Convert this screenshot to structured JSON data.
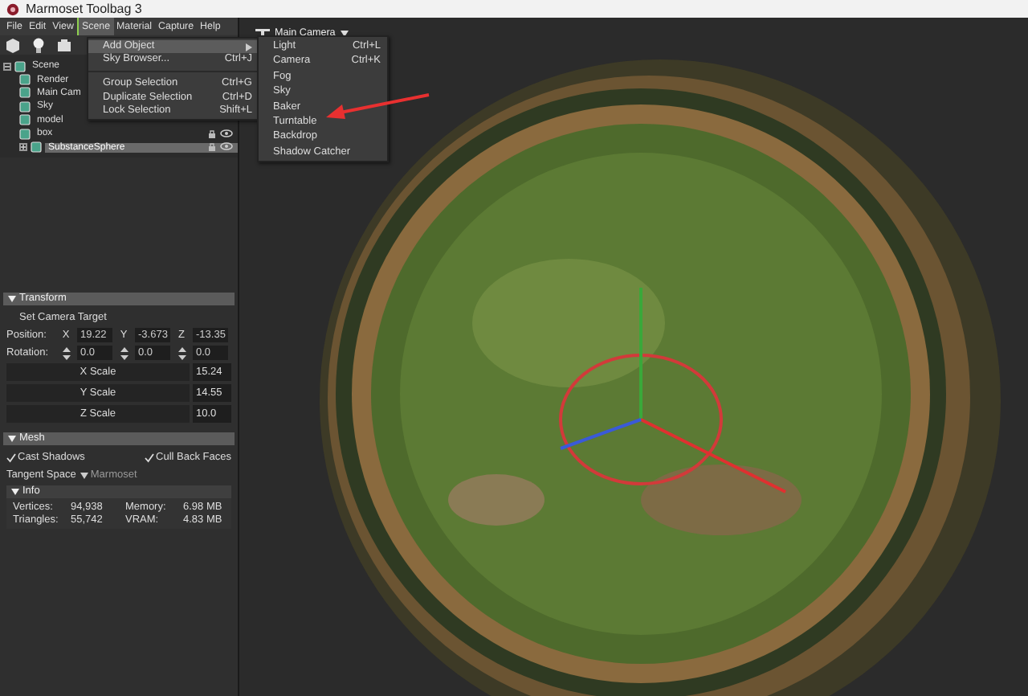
{
  "window": {
    "title": "Marmoset Toolbag 3"
  },
  "menubar": [
    {
      "label": "File",
      "selected": false
    },
    {
      "label": "Edit",
      "selected": false
    },
    {
      "label": "View",
      "selected": false
    },
    {
      "label": "Scene",
      "selected": true
    },
    {
      "label": "Material",
      "selected": false
    },
    {
      "label": "Capture",
      "selected": false
    },
    {
      "label": "Help",
      "selected": false
    }
  ],
  "scene_menu": {
    "groups": [
      [
        {
          "label": "Add Object",
          "kind": "submenu",
          "selected": true
        },
        {
          "label": "Sky Browser...",
          "shortcut": "Ctrl+J",
          "kind": "item",
          "selected": false
        }
      ],
      [
        {
          "label": "Group Selection",
          "shortcut": "Ctrl+G",
          "kind": "item",
          "selected": false
        },
        {
          "label": "Duplicate Selection",
          "shortcut": "Ctrl+D",
          "kind": "item",
          "selected": false
        },
        {
          "label": "Lock Selection",
          "shortcut": "Shift+L",
          "kind": "item",
          "selected": false
        }
      ]
    ]
  },
  "add_object_menu": [
    {
      "label": "Light",
      "shortcut": "Ctrl+L"
    },
    {
      "label": "Camera",
      "shortcut": "Ctrl+K"
    },
    {
      "label": "Fog"
    },
    {
      "label": "Sky"
    },
    {
      "label": "Baker"
    },
    {
      "label": "Turntable"
    },
    {
      "label": "Backdrop"
    },
    {
      "label": "Shadow Catcher"
    }
  ],
  "viewport": {
    "camera_dropdown": "Main Camera"
  },
  "scene_tree": [
    {
      "label": "Scene",
      "expanded": true,
      "selected": false,
      "children": [
        {
          "label": "Render",
          "selected": false
        },
        {
          "label": "Main Cam",
          "selected": false
        },
        {
          "label": "Sky",
          "selected": false
        },
        {
          "label": "model",
          "selected": false
        },
        {
          "label": "box",
          "selected": false
        },
        {
          "label": "SubstanceSphere",
          "expanded": false,
          "selected": true
        }
      ]
    }
  ],
  "transform": {
    "title": "Transform",
    "set_camera_target": "Set Camera Target",
    "position": {
      "label": "Position:",
      "fields": [
        {
          "axis": "X",
          "value": "19.22"
        },
        {
          "axis": "Y",
          "value": "-3.673"
        },
        {
          "axis": "Z",
          "value": "-13.35"
        }
      ]
    },
    "rotation": {
      "label": "Rotation:",
      "fields": [
        {
          "value": "0.0"
        },
        {
          "value": "0.0"
        },
        {
          "value": "0.0"
        }
      ]
    },
    "scales": [
      {
        "label": "X Scale",
        "value": "15.24"
      },
      {
        "label": "Y Scale",
        "value": "14.55"
      },
      {
        "label": "Z Scale",
        "value": "10.0"
      }
    ]
  },
  "mesh": {
    "title": "Mesh",
    "cast_shadows": {
      "label": "Cast Shadows",
      "checked": true
    },
    "cull_back_faces": {
      "label": "Cull Back Faces",
      "checked": true
    },
    "tangent_space": {
      "label": "Tangent Space",
      "value": "Marmoset"
    },
    "info": {
      "title": "Info",
      "stats": [
        {
          "label": "Vertices:",
          "value": "94,938"
        },
        {
          "label": "Memory:",
          "value": "6.98 MB"
        },
        {
          "label": "Triangles:",
          "value": "55,742"
        },
        {
          "label": "VRAM:",
          "value": "4.83 MB"
        }
      ]
    }
  }
}
